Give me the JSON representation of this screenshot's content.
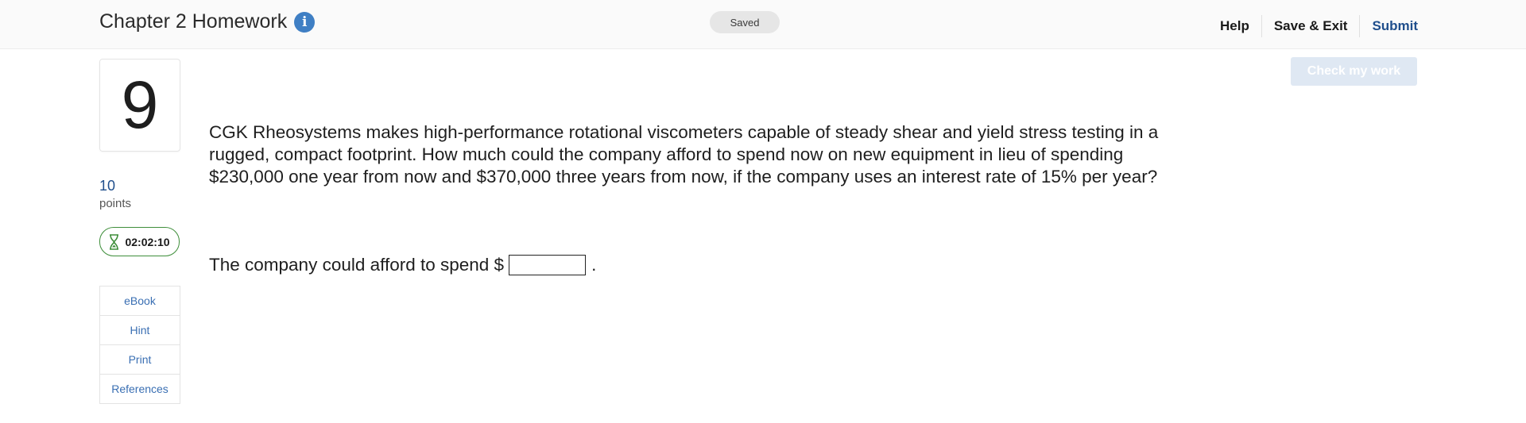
{
  "header": {
    "title": "Chapter 2 Homework",
    "info_icon": "info-icon",
    "saved_status": "Saved",
    "help_label": "Help",
    "save_exit_label": "Save & Exit",
    "submit_label": "Submit"
  },
  "check_work_label": "Check my work",
  "question": {
    "number": "9",
    "points_value": "10",
    "points_label": "points",
    "timer": "02:02:10",
    "timer_icon": "hourglass-icon",
    "text": "CGK Rheosystems makes high-performance rotational viscometers capable of steady shear and yield stress testing in a rugged, compact footprint. How much could the company afford to spend now on new equipment in lieu of spending $230,000 one year from now and $370,000 three years from now, if the company uses an interest rate of 15% per year?",
    "answer_prefix": "The company could afford to spend $",
    "answer_value": "",
    "answer_suffix": "."
  },
  "tools": [
    {
      "label": "eBook"
    },
    {
      "label": "Hint"
    },
    {
      "label": "Print"
    },
    {
      "label": "References"
    }
  ],
  "colors": {
    "accent": "#3f7fc4",
    "link": "#3a6fb3",
    "submit": "#1f4e8c",
    "timer_border": "#3e8e3a",
    "check_button_bg": "#dfe8f3"
  }
}
